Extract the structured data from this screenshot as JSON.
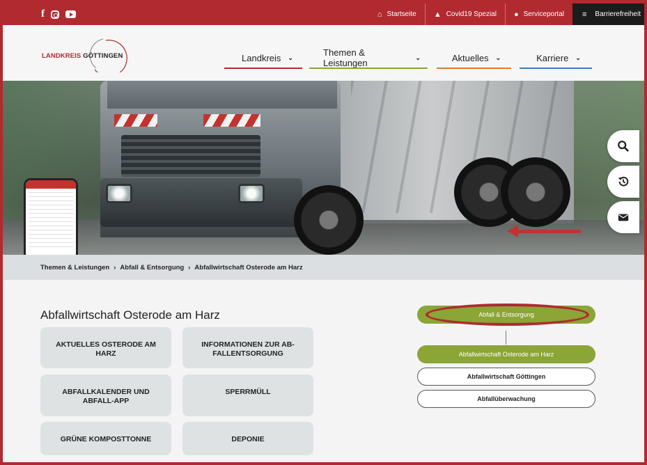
{
  "topbar": {
    "social": [
      "facebook-icon",
      "instagram-icon",
      "youtube-icon"
    ],
    "links": [
      {
        "label": "Startseite",
        "icon": "home-icon"
      },
      {
        "label": "Covid19 Spezial",
        "icon": "warning-icon"
      },
      {
        "label": "Serviceportal",
        "icon": "person-icon"
      }
    ],
    "accessibility": {
      "label": "Barrierefreiheit",
      "icon": "menu-icon"
    }
  },
  "logo": {
    "part1": "LANDKREIS",
    "part2": "GÖTTINGEN"
  },
  "nav": [
    {
      "label": "Landkreis",
      "color": "#b02a30"
    },
    {
      "label": "Themen & Leistungen",
      "color": "#8ba536"
    },
    {
      "label": "Aktuelles",
      "color": "#e07b2a"
    },
    {
      "label": "Karriere",
      "color": "#3a7bbf"
    }
  ],
  "side_buttons": [
    "search-icon",
    "history-icon",
    "mail-icon"
  ],
  "breadcrumb": {
    "items": [
      "Themen & Leistungen",
      "Abfall & Entsorgung",
      "Abfallwirtschaft Osterode am Harz"
    ],
    "separator": "›"
  },
  "main": {
    "title": "Abfallwirtschaft Osterode am Harz",
    "tiles": [
      {
        "lines": [
          "AKTUELLES OSTERODE AM",
          "HARZ"
        ]
      },
      {
        "lines": [
          "INFORMATIONEN ZUR AB-",
          "FALLENTSORGUNG"
        ]
      },
      {
        "lines": [
          "ABFALLKALENDER UND",
          "ABFALL-APP"
        ]
      },
      {
        "lines": [
          "SPERRMÜLL",
          ""
        ]
      },
      {
        "lines": [
          "GRÜNE KOMPOSTTONNE",
          ""
        ]
      },
      {
        "lines": [
          "DEPONIE",
          ""
        ]
      }
    ]
  },
  "sidebar_nav": {
    "parent": "Abfall & Entsorgung",
    "items": [
      {
        "label": "Abfallwirtschaft Osterode am Harz",
        "active": true
      },
      {
        "label": "Abfallwirtschaft Göttingen",
        "active": false
      },
      {
        "label": "Abfallüberwachung",
        "active": false
      }
    ]
  },
  "colors": {
    "brand_red": "#b02a30",
    "green": "#8ba536",
    "orange": "#e07b2a",
    "blue": "#3a7bbf"
  }
}
